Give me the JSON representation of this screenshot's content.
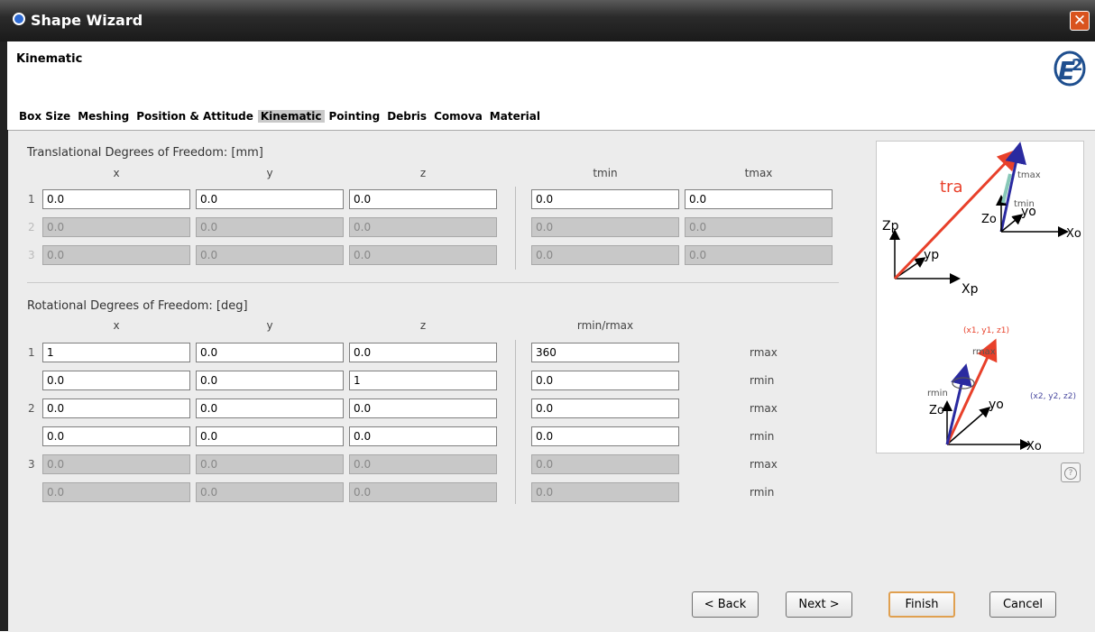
{
  "window": {
    "title": "Shape Wizard",
    "close_label": "✕"
  },
  "page_title": "Kinematic",
  "tabs": [
    {
      "label": "Box Size",
      "active": false
    },
    {
      "label": "Meshing",
      "active": false
    },
    {
      "label": "Position & Attitude",
      "active": false
    },
    {
      "label": "Kinematic",
      "active": true
    },
    {
      "label": "Pointing",
      "active": false
    },
    {
      "label": "Debris",
      "active": false
    },
    {
      "label": "Comova",
      "active": false
    },
    {
      "label": "Material",
      "active": false
    }
  ],
  "translational": {
    "title": "Translational Degrees of Freedom: [mm]",
    "headers": [
      "x",
      "y",
      "z",
      "tmin",
      "tmax"
    ],
    "rows": [
      {
        "num": "1",
        "enabled": true,
        "values": [
          "0.0",
          "0.0",
          "0.0",
          "0.0",
          "0.0"
        ]
      },
      {
        "num": "2",
        "enabled": false,
        "values": [
          "0.0",
          "0.0",
          "0.0",
          "0.0",
          "0.0"
        ]
      },
      {
        "num": "3",
        "enabled": false,
        "values": [
          "0.0",
          "0.0",
          "0.0",
          "0.0",
          "0.0"
        ]
      }
    ]
  },
  "rotational": {
    "title": "Rotational Degrees of Freedom: [deg]",
    "headers": [
      "x",
      "y",
      "z",
      "rmin/rmax"
    ],
    "rows": [
      {
        "num": "1",
        "enabled": true,
        "values": [
          "1",
          "0.0",
          "0.0",
          "360"
        ],
        "label": "rmax"
      },
      {
        "num": "",
        "enabled": true,
        "values": [
          "0.0",
          "0.0",
          "1",
          "0.0"
        ],
        "label": "rmin"
      },
      {
        "num": "2",
        "enabled": true,
        "values": [
          "0.0",
          "0.0",
          "0.0",
          "0.0"
        ],
        "label": "rmax"
      },
      {
        "num": "",
        "enabled": true,
        "values": [
          "0.0",
          "0.0",
          "0.0",
          "0.0"
        ],
        "label": "rmin"
      },
      {
        "num": "3",
        "enabled": false,
        "values": [
          "0.0",
          "0.0",
          "0.0",
          "0.0"
        ],
        "label": "rmax"
      },
      {
        "num": "",
        "enabled": false,
        "values": [
          "0.0",
          "0.0",
          "0.0",
          "0.0"
        ],
        "label": "rmin"
      }
    ]
  },
  "diagram_labels": {
    "tra": "tra",
    "tmax": "tmax",
    "tmin": "tmin",
    "zp": "Zp",
    "yp": "yp",
    "xp": "Xp",
    "zo": "Zo",
    "yo": "yo",
    "xo": "Xo",
    "p1": "(x1, y1, z1)",
    "p2": "(x2, y2, z2)",
    "rmax": "rmax",
    "rmin": "rmin"
  },
  "help_label": "?",
  "buttons": {
    "back": "< Back",
    "next": "Next >",
    "finish": "Finish",
    "cancel": "Cancel"
  },
  "colors": {
    "title_bar": "#2b2b2b",
    "close": "#d9531e",
    "arrow_red": "#e8402a",
    "arrow_blue": "#2a2aa0",
    "default_button_border": "#e0a050"
  }
}
